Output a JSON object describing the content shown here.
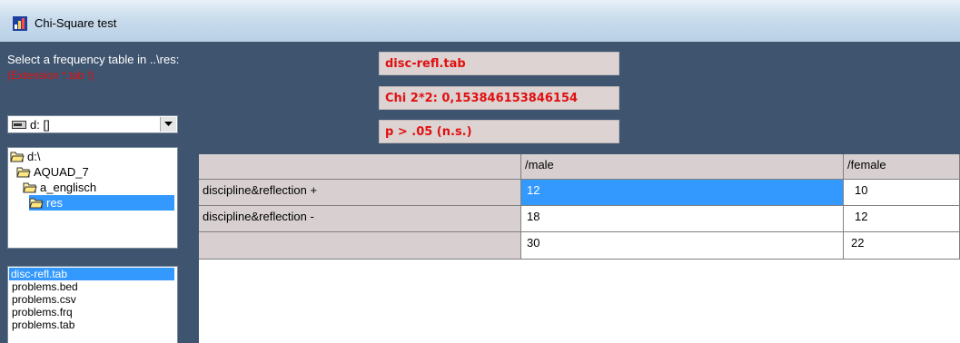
{
  "window": {
    "title": "Chi-Square test"
  },
  "left_panel": {
    "prompt": "Select a frequency table in ..\\res:",
    "hint": "(Extension *.tab !)",
    "drive": {
      "label": "d: []"
    },
    "directories": [
      {
        "label": "d:\\",
        "selected": false
      },
      {
        "label": "AQUAD_7",
        "selected": false
      },
      {
        "label": "a_englisch",
        "selected": false
      },
      {
        "label": "res",
        "selected": true
      }
    ],
    "files": [
      {
        "label": "disc-refl.tab",
        "selected": true
      },
      {
        "label": "problems.bed",
        "selected": false
      },
      {
        "label": "problems.csv",
        "selected": false
      },
      {
        "label": "problems.frq",
        "selected": false
      },
      {
        "label": "problems.tab",
        "selected": false
      }
    ]
  },
  "results": {
    "file_name": "disc-refl.tab",
    "chi_square": "Chi 2*2: 0,153846153846154",
    "p_value": "p > .05 (n.s.)"
  },
  "table": {
    "headers": [
      "",
      "/male",
      "/female"
    ],
    "rows": [
      [
        "discipline&reflection +",
        "12",
        "10"
      ],
      [
        "discipline&reflection -",
        "18",
        "12"
      ],
      [
        "",
        "30",
        "22"
      ]
    ]
  },
  "colors": {
    "background": "#3f546f",
    "accent": "#3399ff",
    "error_text": "#e01010"
  }
}
